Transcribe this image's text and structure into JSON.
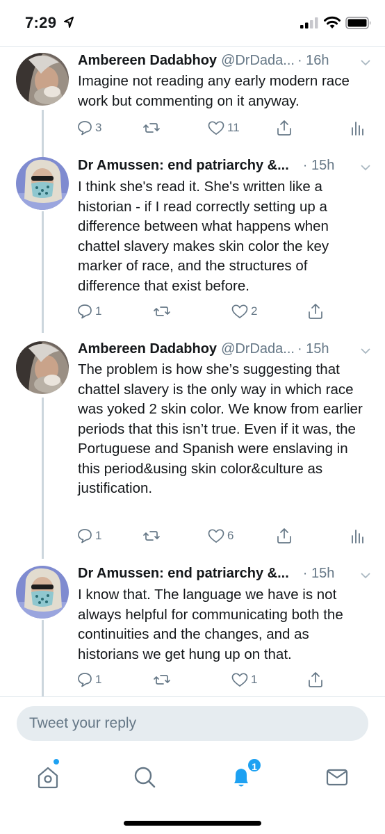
{
  "status_bar": {
    "time": "7:29"
  },
  "tweets": [
    {
      "name": "Ambereen Dadabhoy",
      "handle": "@DrDada...",
      "time": "· 16h",
      "text": "Imagine not reading any early modern race work but commenting on it anyway.",
      "replies": "3",
      "retweets": "",
      "likes": "11"
    },
    {
      "name": "Dr Amussen: end patriarchy &...",
      "handle": "",
      "time": "· 15h",
      "text": "I think she's read it.  She's written like a historian - if I read correctly setting up a difference between what happens when chattel slavery makes skin color the key marker of race, and the structures of difference that exist before.",
      "replies": "1",
      "retweets": "",
      "likes": "2"
    },
    {
      "name": "Ambereen Dadabhoy",
      "handle": "@DrDada...",
      "time": "· 15h",
      "text": "The problem is how she’s suggesting that chattel slavery is the only way in which race was yoked 2 skin color. We know from earlier periods that this isn’t true. Even if it was, the Portuguese and Spanish were enslaving in this period&using skin color&culture as justification.",
      "replies": "1",
      "retweets": "",
      "likes": "6"
    },
    {
      "name": "Dr Amussen: end patriarchy &...",
      "handle": "",
      "time": "· 15h",
      "text": "I know that. The language we have is not always helpful for communicating both the continuities and the changes, and as historians we get hung up on that.",
      "replies": "1",
      "retweets": "",
      "likes": "1"
    }
  ],
  "reply": {
    "placeholder": "Tweet your reply"
  },
  "tab_bar": {
    "items": [
      "home-icon",
      "search-icon",
      "notifications-icon",
      "messages-icon"
    ],
    "notification_count": "1"
  },
  "colors": {
    "accent": "#1da1f2",
    "muted": "#657786",
    "divider": "#e1e8ed",
    "thread_line": "#ccd6dd"
  }
}
